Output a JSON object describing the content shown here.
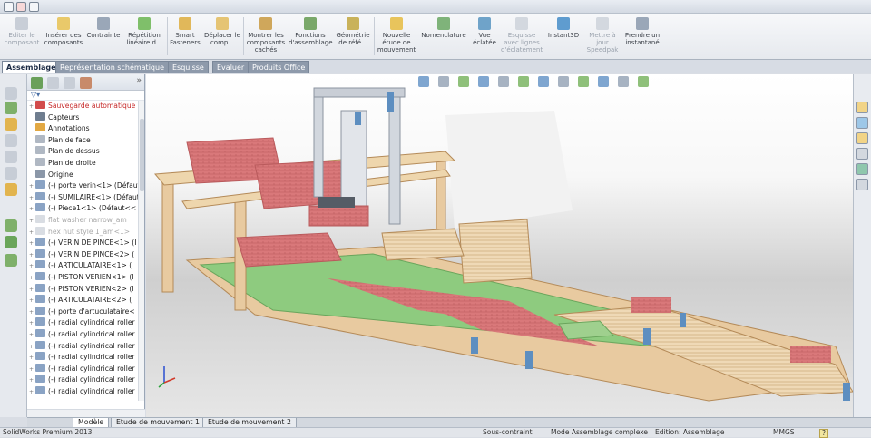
{
  "ribbon": {
    "buttons": [
      {
        "label": "Editer le composant",
        "disabled": true
      },
      {
        "label": "Insérer des composants"
      },
      {
        "label": "Contrainte"
      },
      {
        "label": "Répétition linéaire d..."
      },
      {
        "label": "Smart Fasteners"
      },
      {
        "label": "Déplacer le comp..."
      },
      {
        "label": "Montrer les composants cachés"
      },
      {
        "label": "Fonctions d'assemblage"
      },
      {
        "label": "Géométrie de réfé..."
      },
      {
        "label": "Nouvelle étude de mouvement"
      },
      {
        "label": "Nomenclature"
      },
      {
        "label": "Vue éclatée"
      },
      {
        "label": "Esquisse avec lignes d'éclatement",
        "disabled": true
      },
      {
        "label": "Instant3D"
      },
      {
        "label": "Mettre à jour Speedpak",
        "disabled": true
      },
      {
        "label": "Prendre un instantané"
      }
    ]
  },
  "tabs": [
    "Assemblage",
    "Représentation schématique",
    "Esquisse",
    "Evaluer",
    "Produits Office"
  ],
  "tree": {
    "items": [
      {
        "label": "Sauvegarde automatique",
        "style": "warn"
      },
      {
        "label": "Capteurs"
      },
      {
        "label": "Annotations"
      },
      {
        "label": "Plan de face"
      },
      {
        "label": "Plan de dessus"
      },
      {
        "label": "Plan de droite"
      },
      {
        "label": "Origine"
      },
      {
        "label": "(-) porte verin<1> (Défaut"
      },
      {
        "label": "(-) SUMILAIRE<1> (Défaut"
      },
      {
        "label": "(-) Piece1<1> (Défaut<<"
      },
      {
        "label": "flat washer narrow_am",
        "style": "grey"
      },
      {
        "label": "hex nut style 1_am<1>",
        "style": "grey"
      },
      {
        "label": "(-) VERIN DE PINCE<1> (I"
      },
      {
        "label": "(-) VERIN DE PINCE<2> ("
      },
      {
        "label": "(-) ARTICULATAIRE<1> ("
      },
      {
        "label": "(-) PISTON VERIEN<1> (I"
      },
      {
        "label": "(-) PISTON VERIEN<2> (I"
      },
      {
        "label": "(-) ARTICULATAIRE<2> ("
      },
      {
        "label": "(-) porte d'artuculataire<"
      },
      {
        "label": "(-) radial cylindrical roller"
      },
      {
        "label": "(-) radial cylindrical roller"
      },
      {
        "label": "(-) radial cylindrical roller"
      },
      {
        "label": "(-) radial cylindrical roller"
      },
      {
        "label": "(-) radial cylindrical roller"
      },
      {
        "label": "(-) radial cylindrical roller"
      },
      {
        "label": "(-) radial cylindrical roller"
      }
    ]
  },
  "bottom_tabs": [
    "Modèle",
    "Etude de mouvement 1",
    "Etude de mouvement 2"
  ],
  "status": {
    "product": "SolidWorks Premium 2013",
    "constraint": "Sous-contraint",
    "mode": "Mode Assemblage complexe",
    "edition": "Edition: Assemblage",
    "units": "MMGS",
    "help": "?"
  },
  "colors": {
    "accent": "#4a6fa5",
    "brick": "#d9787a",
    "wood": "#e8caa0",
    "green": "#7fc27a"
  }
}
